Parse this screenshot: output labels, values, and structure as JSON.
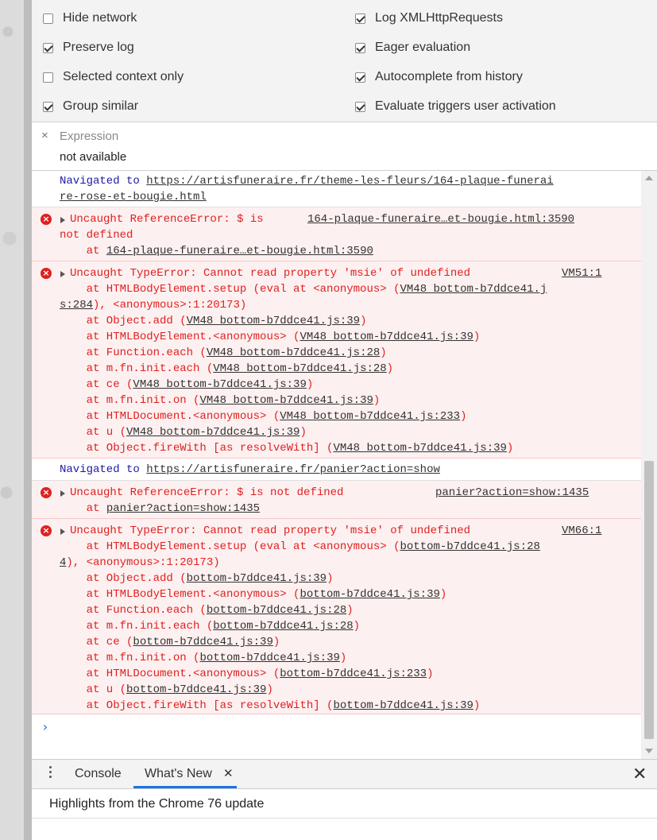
{
  "settings": {
    "options": [
      {
        "label": "Hide network",
        "checked": false
      },
      {
        "label": "Preserve log",
        "checked": true
      },
      {
        "label": "Selected context only",
        "checked": false
      },
      {
        "label": "Group similar",
        "checked": true
      },
      {
        "label": "Log XMLHttpRequests",
        "checked": true
      },
      {
        "label": "Eager evaluation",
        "checked": true
      },
      {
        "label": "Autocomplete from history",
        "checked": true
      },
      {
        "label": "Evaluate triggers user activation",
        "checked": true
      }
    ]
  },
  "expression": {
    "close_icon": "×",
    "label": "Expression",
    "value": "not available"
  },
  "console": {
    "messages": [
      {
        "type": "nav",
        "prefix": "Navigated to ",
        "url_line1": "https://artisfuneraire.fr/theme-les-fleurs/164-plaque-funerai",
        "url_line2": "re-rose-et-bougie.html"
      },
      {
        "type": "error",
        "line1": "Uncaught ReferenceError: $ is",
        "line2": "not defined",
        "source": "164-plaque-funeraire…et-bougie.html:3590",
        "stack_prefix": "    at ",
        "stack_link": "164-plaque-funeraire…et-bougie.html:3590"
      },
      {
        "type": "error",
        "line1": "Uncaught TypeError: Cannot read property 'msie' of undefined",
        "source": "VM51:1",
        "stack": [
          {
            "text": "    at HTMLBodyElement.setup (eval at <anonymous> (",
            "link": "VM48 bottom-b7ddce41.j"
          },
          {
            "text": "",
            "link": "s:284",
            "after": "), <anonymous>:1:20173)"
          },
          {
            "text": "    at Object.add (",
            "link": "VM48 bottom-b7ddce41.js:39",
            "after": ")"
          },
          {
            "text": "    at HTMLBodyElement.<anonymous> (",
            "link": "VM48 bottom-b7ddce41.js:39",
            "after": ")"
          },
          {
            "text": "    at Function.each (",
            "link": "VM48 bottom-b7ddce41.js:28",
            "after": ")"
          },
          {
            "text": "    at m.fn.init.each (",
            "link": "VM48 bottom-b7ddce41.js:28",
            "after": ")"
          },
          {
            "text": "    at ce (",
            "link": "VM48 bottom-b7ddce41.js:39",
            "after": ")"
          },
          {
            "text": "    at m.fn.init.on (",
            "link": "VM48 bottom-b7ddce41.js:39",
            "after": ")"
          },
          {
            "text": "    at HTMLDocument.<anonymous> (",
            "link": "VM48 bottom-b7ddce41.js:233",
            "after": ")"
          },
          {
            "text": "    at u (",
            "link": "VM48 bottom-b7ddce41.js:39",
            "after": ")"
          },
          {
            "text": "    at Object.fireWith [as resolveWith] (",
            "link": "VM48 bottom-b7ddce41.js:39",
            "after": ")"
          }
        ]
      },
      {
        "type": "nav",
        "prefix": "Navigated to ",
        "url_line1": "https://artisfuneraire.fr/panier?action=show"
      },
      {
        "type": "error",
        "line1": "Uncaught ReferenceError: $ is not defined",
        "source": "panier?action=show:1435",
        "stack_prefix": "    at ",
        "stack_link": "panier?action=show:1435"
      },
      {
        "type": "error",
        "line1": "Uncaught TypeError: Cannot read property 'msie' of undefined",
        "source": "VM66:1",
        "stack": [
          {
            "text": "    at HTMLBodyElement.setup (eval at <anonymous> (",
            "link": "bottom-b7ddce41.js:28"
          },
          {
            "text": "",
            "link": "4",
            "after": "), <anonymous>:1:20173)"
          },
          {
            "text": "    at Object.add (",
            "link": "bottom-b7ddce41.js:39",
            "after": ")"
          },
          {
            "text": "    at HTMLBodyElement.<anonymous> (",
            "link": "bottom-b7ddce41.js:39",
            "after": ")"
          },
          {
            "text": "    at Function.each (",
            "link": "bottom-b7ddce41.js:28",
            "after": ")"
          },
          {
            "text": "    at m.fn.init.each (",
            "link": "bottom-b7ddce41.js:28",
            "after": ")"
          },
          {
            "text": "    at ce (",
            "link": "bottom-b7ddce41.js:39",
            "after": ")"
          },
          {
            "text": "    at m.fn.init.on (",
            "link": "bottom-b7ddce41.js:39",
            "after": ")"
          },
          {
            "text": "    at HTMLDocument.<anonymous> (",
            "link": "bottom-b7ddce41.js:233",
            "after": ")"
          },
          {
            "text": "    at u (",
            "link": "bottom-b7ddce41.js:39",
            "after": ")"
          },
          {
            "text": "    at Object.fireWith [as resolveWith] (",
            "link": "bottom-b7ddce41.js:39",
            "after": ")"
          }
        ]
      }
    ],
    "prompt": "›"
  },
  "drawer": {
    "tabs": [
      {
        "label": "Console"
      },
      {
        "label": "What's New",
        "close": "✕"
      }
    ],
    "close_icon": "✕",
    "highlights": "Highlights from the Chrome 76 update"
  },
  "colors": {
    "error_bg": "#fdf0f0",
    "error_text": "#e02020",
    "nav_text": "#1a1aa6",
    "accent": "#1a73e8"
  }
}
